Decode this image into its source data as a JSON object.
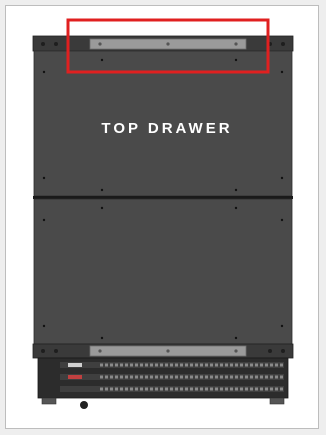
{
  "diagram": {
    "label": "TOP DRAWER",
    "highlight_color": "#e02020",
    "cabinet_color": "#4a4a4a",
    "bracket_color": "#9a9a9a"
  }
}
